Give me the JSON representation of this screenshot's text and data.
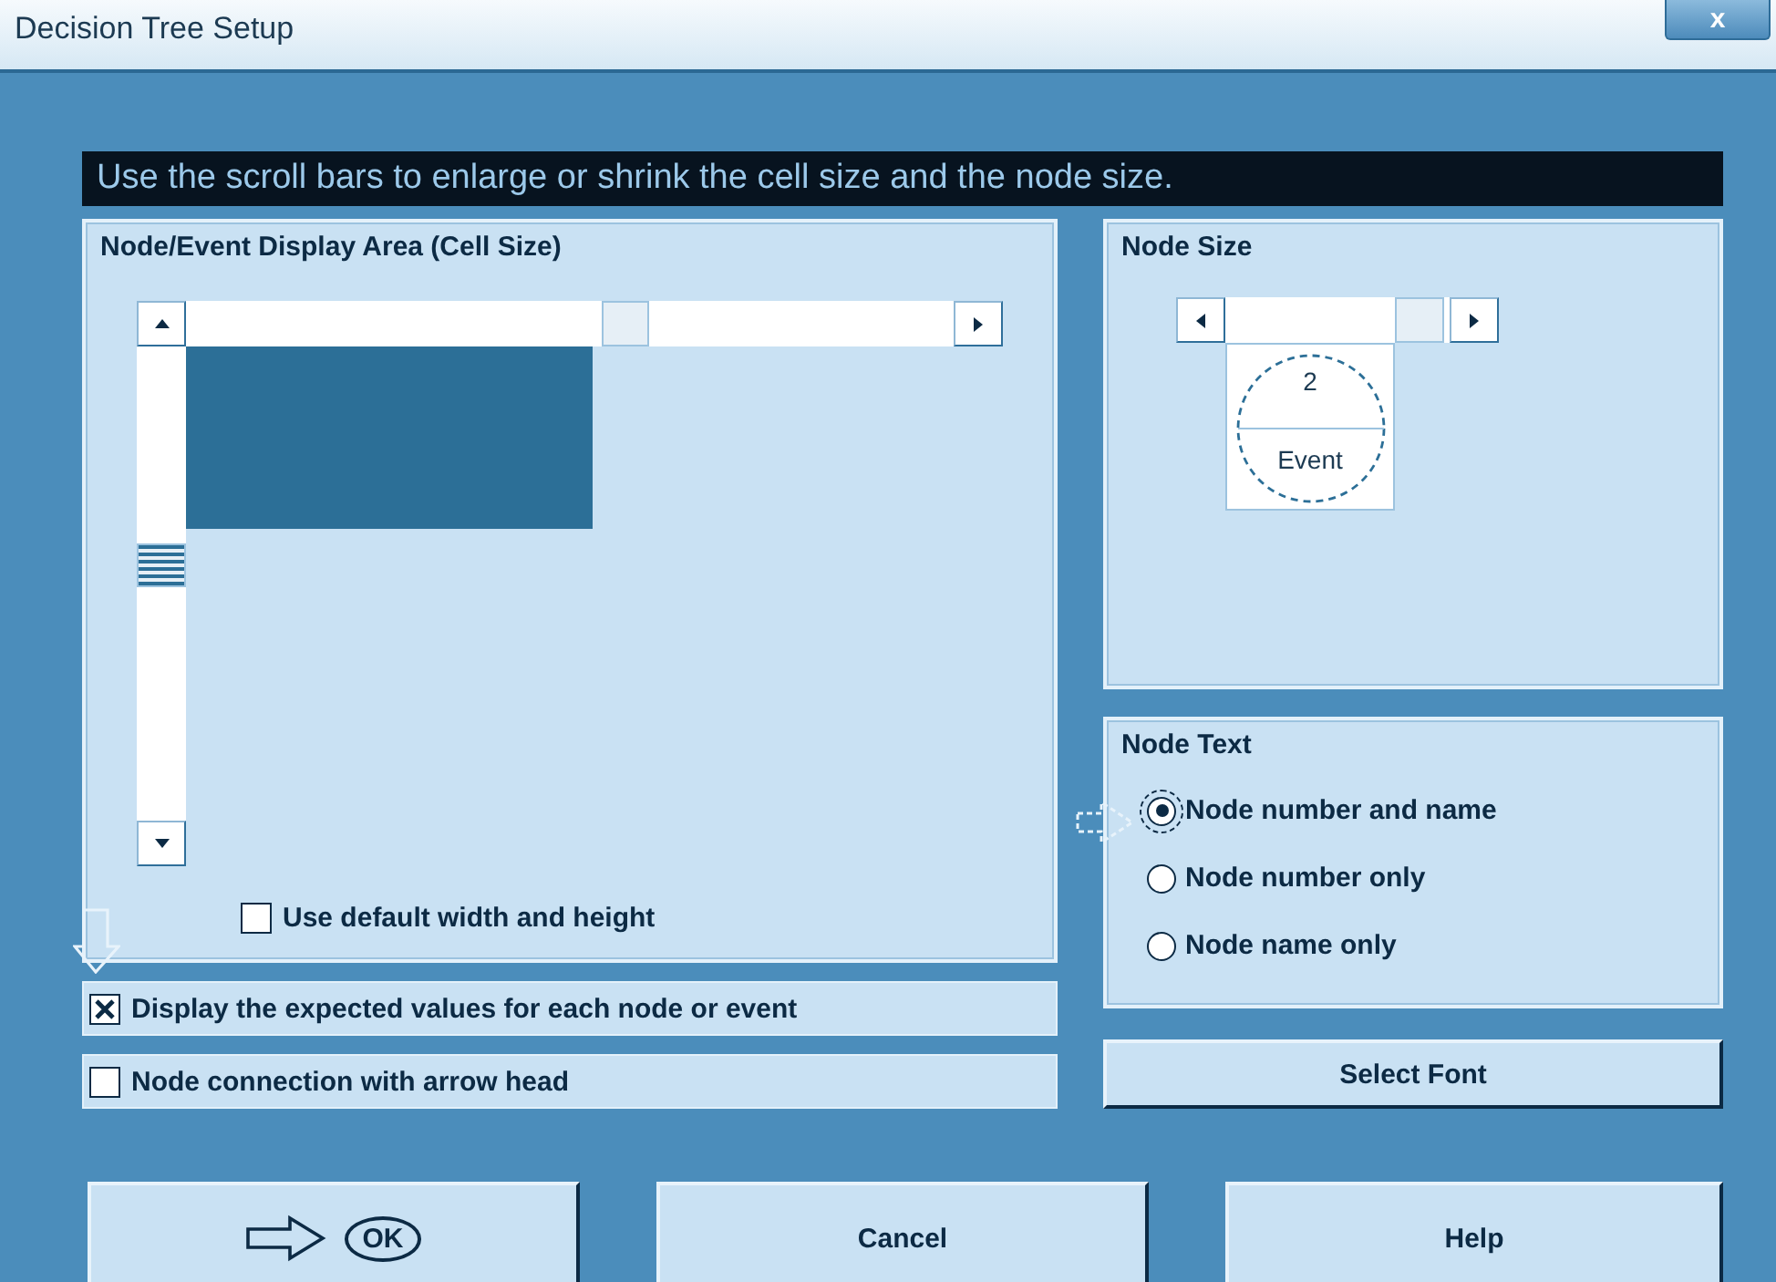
{
  "window": {
    "title": "Decision Tree Setup",
    "close_label": "x"
  },
  "instruction": "Use the scroll bars to enlarge or shrink the cell size and the node size.",
  "cell_size_group": {
    "title": "Node/Event Display Area (Cell Size)",
    "use_default": {
      "label": "Use default width and height",
      "checked": false
    }
  },
  "node_size_group": {
    "title": "Node Size",
    "node_number": "2",
    "node_name": "Event"
  },
  "node_text_group": {
    "title": "Node Text",
    "options": [
      {
        "label": "Node number and name",
        "selected": true
      },
      {
        "label": "Node number only",
        "selected": false
      },
      {
        "label": "Node name only",
        "selected": false
      }
    ]
  },
  "select_font_button": "Select Font",
  "options": [
    {
      "label": "Display the expected values for each node or event",
      "checked": true
    },
    {
      "label": "Node connection with arrow head",
      "checked": false
    }
  ],
  "buttons": [
    {
      "label": "OK",
      "kind": "ok"
    },
    {
      "label": "Cancel",
      "kind": "plain"
    },
    {
      "label": "Help",
      "kind": "plain"
    }
  ]
}
